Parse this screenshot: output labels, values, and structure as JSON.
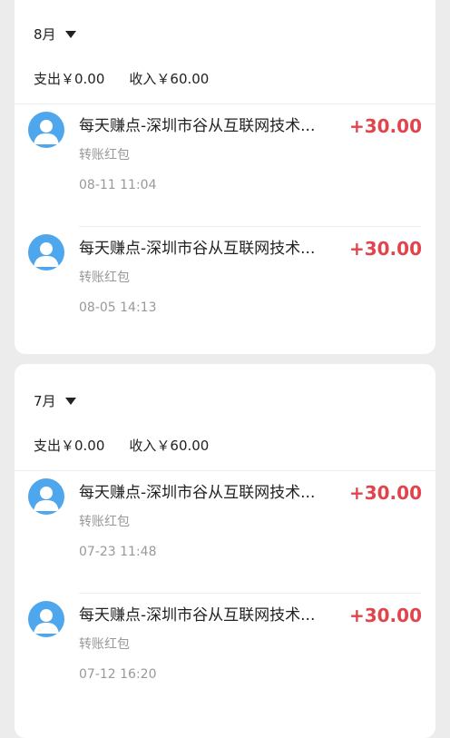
{
  "months": [
    {
      "label": "8月",
      "summary": {
        "expense": "支出￥0.00",
        "income": "收入￥60.00"
      },
      "transactions": [
        {
          "title": "每天赚点-深圳市谷从互联网技术...",
          "type": "转账红包",
          "time": "08-11 11:04",
          "amount": "+30.00"
        },
        {
          "title": "每天赚点-深圳市谷从互联网技术...",
          "type": "转账红包",
          "time": "08-05 14:13",
          "amount": "+30.00"
        }
      ]
    },
    {
      "label": "7月",
      "summary": {
        "expense": "支出￥0.00",
        "income": "收入￥60.00"
      },
      "transactions": [
        {
          "title": "每天赚点-深圳市谷从互联网技术...",
          "type": "转账红包",
          "time": "07-23 11:48",
          "amount": "+30.00"
        },
        {
          "title": "每天赚点-深圳市谷从互联网技术...",
          "type": "转账红包",
          "time": "07-12 16:20",
          "amount": "+30.00"
        }
      ]
    }
  ],
  "icons": {
    "avatar": "user-avatar-icon",
    "caret": "caret-down-icon"
  },
  "colors": {
    "amount": "#e0454e",
    "avatar": "#4ea6ec",
    "secondary_text": "#999999"
  }
}
